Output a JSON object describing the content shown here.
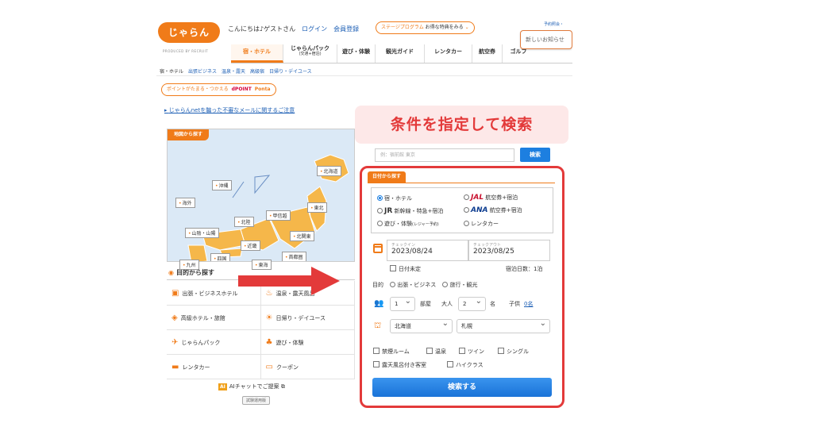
{
  "header": {
    "logo_text": "じゃらん",
    "logo_sub": "PRODUCED BY RECRUIT",
    "greeting": "こんにちは♪ゲストさん",
    "login": "ログイン",
    "register": "会員登録",
    "stage_program": "ステージプログラム",
    "stage_benefit": "お得な特典をみる",
    "reserve_link": "予約照会・",
    "notice": "新しいお知らせ"
  },
  "nav": {
    "tabs": [
      {
        "label": "宿・ホテル",
        "sub": ""
      },
      {
        "label": "じゃらんパック",
        "sub": "(交通+宿泊)"
      },
      {
        "label": "遊び・体験",
        "sub": ""
      },
      {
        "label": "観光ガイド",
        "sub": ""
      },
      {
        "label": "レンタカー",
        "sub": ""
      },
      {
        "label": "航空券",
        "sub": ""
      },
      {
        "label": "ゴルフ",
        "sub": ""
      }
    ],
    "subnav": [
      "宿・ホテル",
      "出張ビジネス",
      "温泉・露天",
      "高級宿",
      "日帰り・デイユース"
    ]
  },
  "points": {
    "label": "ポイントがたまる・つかえる",
    "dpoint": "dPOINT",
    "ponta": "Ponta"
  },
  "alert_link": "じゃらんnetを騙った不審なメールに関するご注意",
  "map": {
    "heading": "地図から探す",
    "regions": [
      "北海道",
      "沖縄",
      "海外",
      "東北",
      "甲信越",
      "北陸",
      "北関東",
      "山陰・山陽",
      "近畿",
      "首都圏",
      "四国",
      "九州",
      "東海"
    ]
  },
  "purpose": {
    "heading": "目的から探す",
    "items": [
      {
        "label": "出張・ビジネスホテル"
      },
      {
        "label": "温泉・露天風呂"
      },
      {
        "label": "高級ホテル・旅館"
      },
      {
        "label": "日帰り・デイユース"
      },
      {
        "label": "じゃらんパック"
      },
      {
        "label": "遊び・体験"
      },
      {
        "label": "レンタカー"
      },
      {
        "label": "クーポン"
      }
    ],
    "ai_chat": "AIチャットでご提案",
    "ai_badge": "AI",
    "trial": "試験運用版"
  },
  "search": {
    "title": "条件を指定して検索",
    "keyword_placeholder": "例：宿前館 東京",
    "keyword_button": "検索",
    "date_tab": "日付から探す",
    "types": {
      "hotel": "宿・ホテル",
      "jal_logo": "JAL",
      "jal_text": "航空券+宿泊",
      "jr_logo": "JR",
      "jr_text": "新幹線・特急+宿泊",
      "ana_logo": "ANA",
      "ana_text": "航空券+宿泊",
      "play": "遊び・体験",
      "play_sub": "(レジャー予約)",
      "rental": "レンタカー"
    },
    "checkin_label": "チェックイン",
    "checkin_value": "2023/08/24",
    "checkout_label": "チェックアウト",
    "checkout_value": "2023/08/25",
    "undecided": "日付未定",
    "nights": "宿泊日数：1泊",
    "purpose_label": "目的",
    "purpose_business": "出張・ビジネス",
    "purpose_travel": "旅行・観光",
    "rooms_value": "1",
    "rooms_label": "部屋",
    "adults_label": "大人",
    "adults_value": "2",
    "adults_unit": "名",
    "children_label": "子供",
    "children_value": "0名",
    "pref_value": "北海道",
    "area_value": "札幌",
    "conditions": [
      "禁煙ルーム",
      "温泉",
      "ツイン",
      "シングル",
      "露天風呂付き客室",
      "ハイクラス"
    ],
    "submit": "検索する"
  },
  "colors": {
    "brand_orange": "#f07b19",
    "highlight_red": "#e33a3a",
    "link_blue": "#1d5fb5",
    "button_blue": "#1d7fe0"
  }
}
